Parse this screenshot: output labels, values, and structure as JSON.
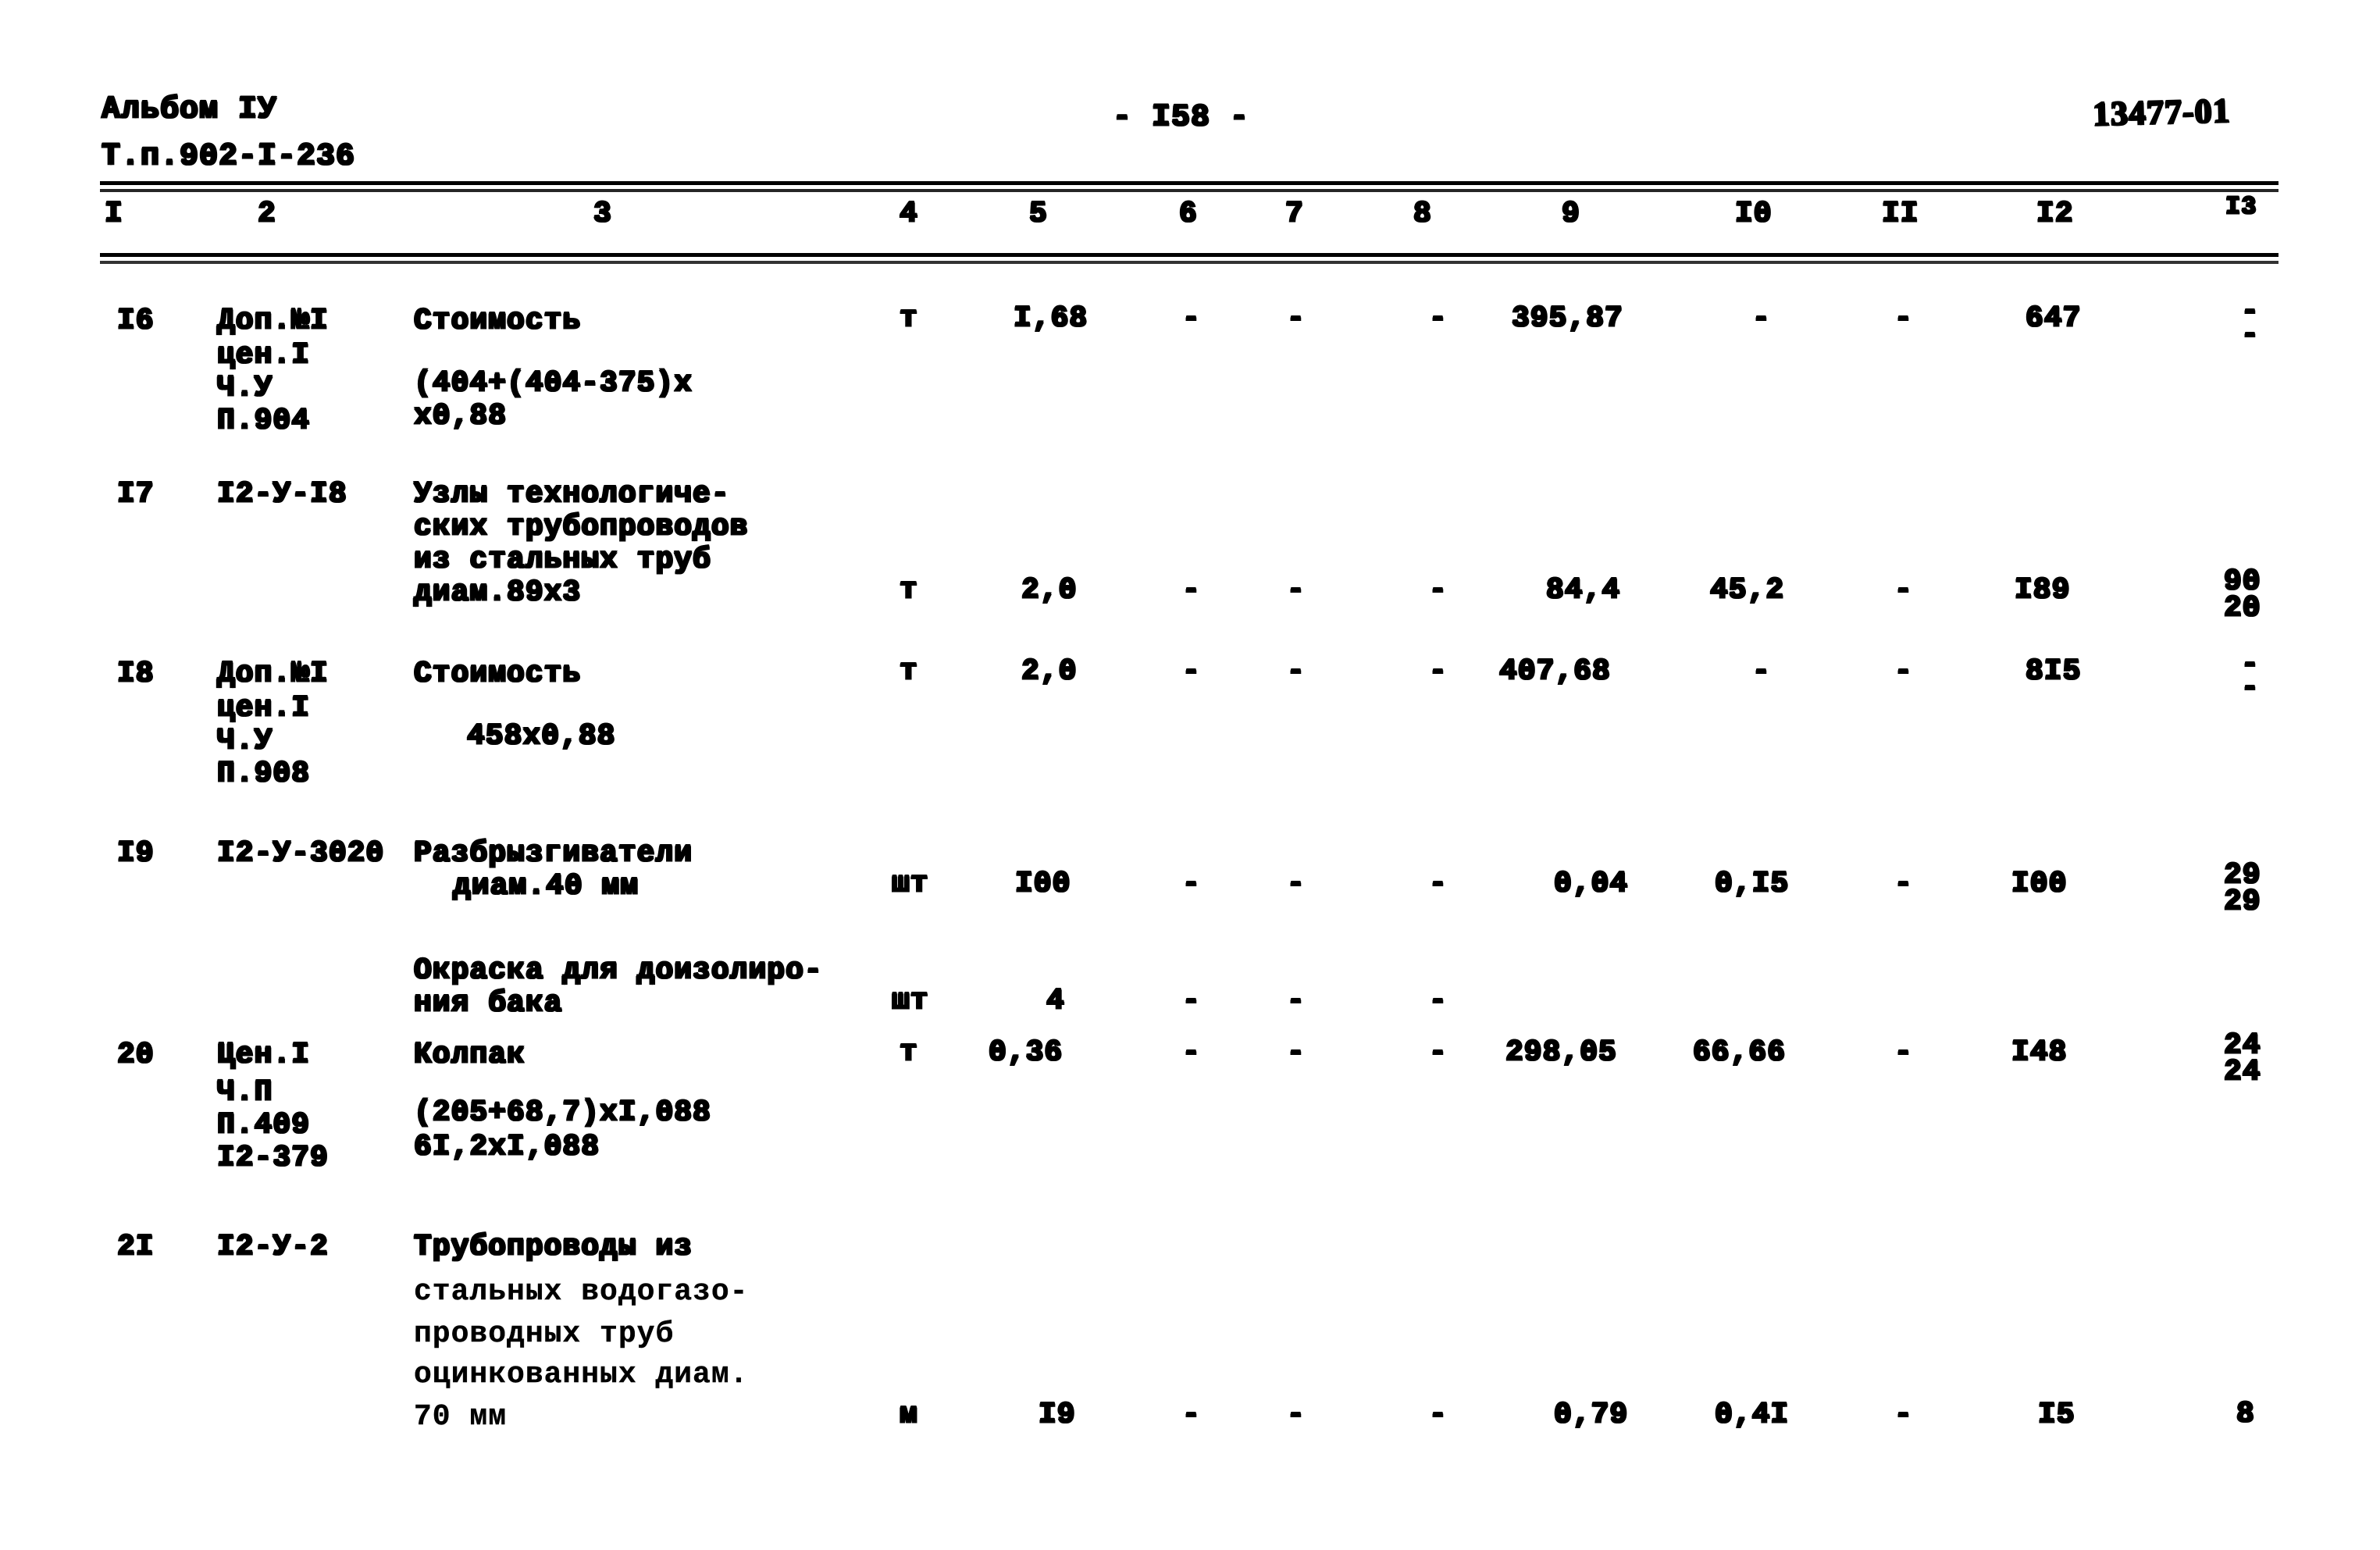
{
  "document": {
    "album_label": "Альбом IУ",
    "project_code": "Т.п.902-I-236",
    "page_number": "- I58 -",
    "stamp_code": "13477-01"
  },
  "table": {
    "column_numbers": [
      "I",
      "2",
      "3",
      "4",
      "5",
      "6",
      "7",
      "8",
      "9",
      "I0",
      "II",
      "I2",
      "I3"
    ],
    "rows": [
      {
        "pos": "I6",
        "code": [
          "Доп.№I",
          "цен.I",
          "Ч.У",
          "П.904"
        ],
        "name": [
          "Стоимость",
          "(404+(404-375)х",
          "х0,88"
        ],
        "unit": "т",
        "qty": "I,68",
        "c6": "-",
        "c7": "-",
        "c8": "-",
        "c9": "395,87",
        "c10": "-",
        "c11": "-",
        "c12": "647",
        "c13": [
          "-",
          "-"
        ]
      },
      {
        "pos": "I7",
        "code": [
          "I2-У-I8"
        ],
        "name": [
          "Узлы технологиче-",
          "ских трубопроводов",
          "из стальных труб",
          "диам.89х3"
        ],
        "unit": "т",
        "qty": "2,0",
        "c6": "-",
        "c7": "-",
        "c8": "-",
        "c9": "84,4",
        "c10": "45,2",
        "c11": "-",
        "c12": "I89",
        "c13": [
          "90",
          "20"
        ]
      },
      {
        "pos": "I8",
        "code": [
          "Доп.№I",
          "цен.I",
          "Ч.У",
          "П.908"
        ],
        "name": [
          "Стоимость",
          "458х0,88"
        ],
        "unit": "т",
        "qty": "2,0",
        "c6": "-",
        "c7": "-",
        "c8": "-",
        "c9": "407,68",
        "c10": "-",
        "c11": "-",
        "c12": "8I5",
        "c13": [
          "-",
          "-"
        ]
      },
      {
        "pos": "I9",
        "code": [
          "I2-У-3020"
        ],
        "name": [
          "Разбрызгиватели",
          "диам.40 мм"
        ],
        "unit": "шт",
        "qty": "I00",
        "c6": "-",
        "c7": "-",
        "c8": "-",
        "c9": "0,04",
        "c10": "0,I5",
        "c11": "-",
        "c12": "I00",
        "c13": [
          "29",
          "29"
        ]
      },
      {
        "pos": "",
        "code": [],
        "name": [
          "Окраска для доизолиро-",
          "ния бака"
        ],
        "unit": "шт",
        "qty": "4",
        "c6": "-",
        "c7": "-",
        "c8": "-",
        "c9": "",
        "c10": "",
        "c11": "",
        "c12": "",
        "c13": [
          "",
          ""
        ]
      },
      {
        "pos": "20",
        "code": [
          "Цен.I",
          "Ч.П",
          "П.409",
          "I2-379"
        ],
        "name": [
          "Колпак",
          "(205+68,7)хI,088",
          "6I,2хI,088"
        ],
        "unit": "т",
        "qty": "0,36",
        "c6": "-",
        "c7": "-",
        "c8": "-",
        "c9": "298,05",
        "c10": "66,66",
        "c11": "-",
        "c12": "I48",
        "c13": [
          "24",
          "24"
        ]
      },
      {
        "pos": "2I",
        "code": [
          "I2-У-2"
        ],
        "name": [
          "Трубопроводы из",
          "стальных водогазо-",
          "проводных труб",
          "оцинкованных диам.",
          "70 мм"
        ],
        "unit": "м",
        "qty": "I9",
        "c6": "-",
        "c7": "-",
        "c8": "-",
        "c9": "0,79",
        "c10": "0,4I",
        "c11": "-",
        "c12": "I5",
        "c13": [
          "8",
          ""
        ]
      }
    ]
  }
}
